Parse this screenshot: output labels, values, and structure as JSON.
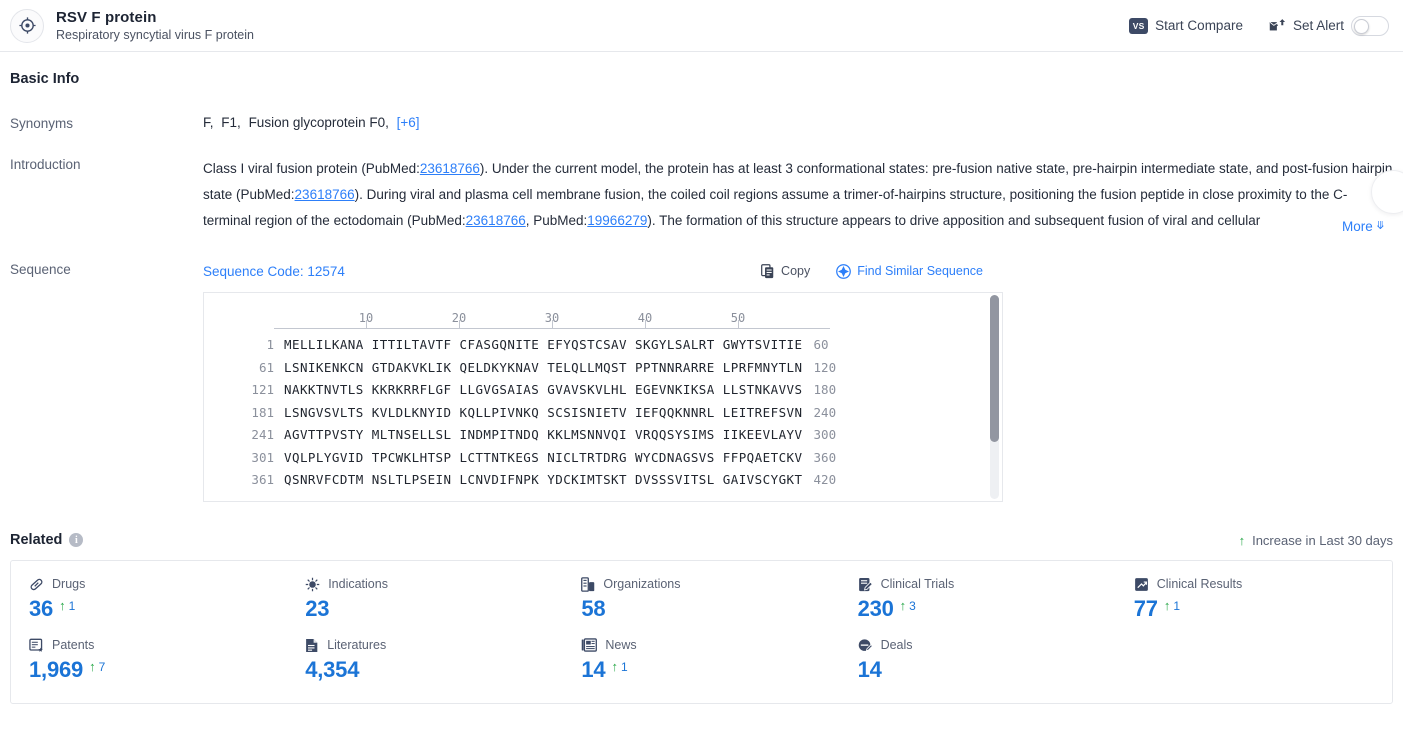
{
  "header": {
    "logo_icon": "target-crosshair-icon",
    "title": "RSV F protein",
    "subtitle": "Respiratory syncytial virus F protein",
    "compare_badge": "VS",
    "compare_label": "Start Compare",
    "alert_icon": "mail-alert-icon",
    "alert_label": "Set Alert",
    "alert_toggle_state": "off"
  },
  "basic_info": {
    "section_title": "Basic Info",
    "synonyms": {
      "label": "Synonyms",
      "items": [
        "F,",
        "F1,",
        "Fusion glycoprotein F0,"
      ],
      "more_count": "[+6]"
    },
    "introduction": {
      "label": "Introduction",
      "part1": "Class I viral fusion protein (PubMed:",
      "ref1": "23618766",
      "part2": "). Under the current model, the protein has at least 3 conformational states: pre-fusion native state, pre-hairpin intermediate state, and post-fusion hairpin state (PubMed:",
      "ref2": "23618766",
      "part3": "). During viral and plasma cell membrane fusion, the coiled coil regions assume a trimer-of-hairpins structure, positioning the fusion peptide in close proximity to the C-terminal region of the ectodomain (PubMed:",
      "ref3": "23618766",
      "part4": ", PubMed:",
      "ref4": "19966279",
      "part5": "). The formation of this structure appears to drive apposition and subsequent fusion of viral and cellular",
      "more_label": "More"
    },
    "sequence": {
      "label": "Sequence",
      "code_label": "Sequence Code: 12574",
      "copy_label": "Copy",
      "copy_icon": "copy-icon",
      "find_similar_label": "Find Similar Sequence",
      "find_similar_icon": "compass-search-icon",
      "ruler_ticks": [
        "10",
        "20",
        "30",
        "40",
        "50"
      ],
      "rows": [
        {
          "start": "1",
          "chunks": [
            "MELLILKANA",
            "ITTILTAVTF",
            "CFASGQNITE",
            "EFYQSTCSAV",
            "SKGYLSALRT",
            "GWYTSVITIE"
          ],
          "end": "60"
        },
        {
          "start": "61",
          "chunks": [
            "LSNIKENKCN",
            "GTDAKVKLIK",
            "QELDKYKNAV",
            "TELQLLMQST",
            "PPTNNRARRE",
            "LPRFMNYTLN"
          ],
          "end": "120"
        },
        {
          "start": "121",
          "chunks": [
            "NAKKTNVTLS",
            "KKRKRRFLGF",
            "LLGVGSAIAS",
            "GVAVSKVLHL",
            "EGEVNKIKSA",
            "LLSTNKAVVS"
          ],
          "end": "180"
        },
        {
          "start": "181",
          "chunks": [
            "LSNGVSVLTS",
            "KVLDLKNYID",
            "KQLLPIVNKQ",
            "SCSISNIETV",
            "IEFQQKNNRL",
            "LEITREFSVN"
          ],
          "end": "240"
        },
        {
          "start": "241",
          "chunks": [
            "AGVTTPVSTY",
            "MLTNSELLSL",
            "INDMPITNDQ",
            "KKLMSNNVQI",
            "VRQQSYSIMS",
            "IIKEEVLAYV"
          ],
          "end": "300"
        },
        {
          "start": "301",
          "chunks": [
            "VQLPLYGVID",
            "TPCWKLHTSP",
            "LCTTNTKEGS",
            "NICLTRTDRG",
            "WYCDNAGSVS",
            "FFPQAETCKV"
          ],
          "end": "360"
        },
        {
          "start": "361",
          "chunks": [
            "QSNRVFCDTM",
            "NSLTLPSEIN",
            "LCNVDIFNPK",
            "YDCKIMTSKT",
            "DVSSSVITSL",
            "GAIVSCYGKT"
          ],
          "end": "420"
        }
      ]
    }
  },
  "related": {
    "title": "Related",
    "info_glyph": "i",
    "legend": "Increase in Last 30 days",
    "legend_arrow": "↑",
    "cards": [
      {
        "label": "Drugs",
        "icon": "pill-capsule-icon",
        "value": "36",
        "delta": "1"
      },
      {
        "label": "Indications",
        "icon": "virus-icon",
        "value": "23",
        "delta": ""
      },
      {
        "label": "Organizations",
        "icon": "building-icon",
        "value": "58",
        "delta": ""
      },
      {
        "label": "Clinical Trials",
        "icon": "clipboard-pen-icon",
        "value": "230",
        "delta": "3"
      },
      {
        "label": "Clinical Results",
        "icon": "chart-arrow-icon",
        "value": "77",
        "delta": "1"
      },
      {
        "label": "Patents",
        "icon": "certificate-star-icon",
        "value": "1,969",
        "delta": "7"
      },
      {
        "label": "Literatures",
        "icon": "document-lines-icon",
        "value": "4,354",
        "delta": ""
      },
      {
        "label": "News",
        "icon": "newspaper-icon",
        "value": "14",
        "delta": "1"
      },
      {
        "label": "Deals",
        "icon": "handshake-tag-icon",
        "value": "14",
        "delta": ""
      }
    ]
  },
  "colors": {
    "accent_blue": "#2d7ff9",
    "value_blue": "#1b74d6",
    "up_green": "#2aa84a",
    "label_gray": "#5a6274",
    "title_dark": "#1d2433"
  }
}
